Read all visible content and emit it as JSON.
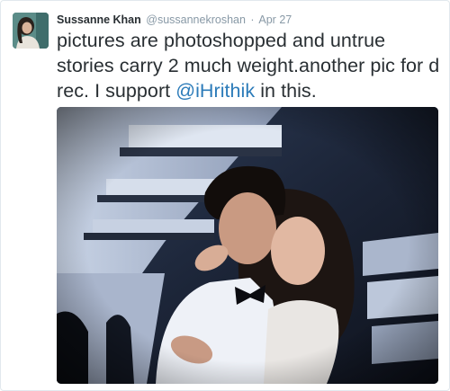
{
  "tweet": {
    "author_name": "Sussanne Khan",
    "author_handle": "@sussannekroshan",
    "separator": "·",
    "date": "Apr 27",
    "text_before_mention": "pictures are photoshopped and untrue stories carry 2 much weight.another pic for d rec. I support ",
    "mention": "@iHrithik",
    "text_after_mention": " in this."
  },
  "colors": {
    "link": "#2b7bb9",
    "meta": "#8899a6",
    "text": "#292f33"
  }
}
